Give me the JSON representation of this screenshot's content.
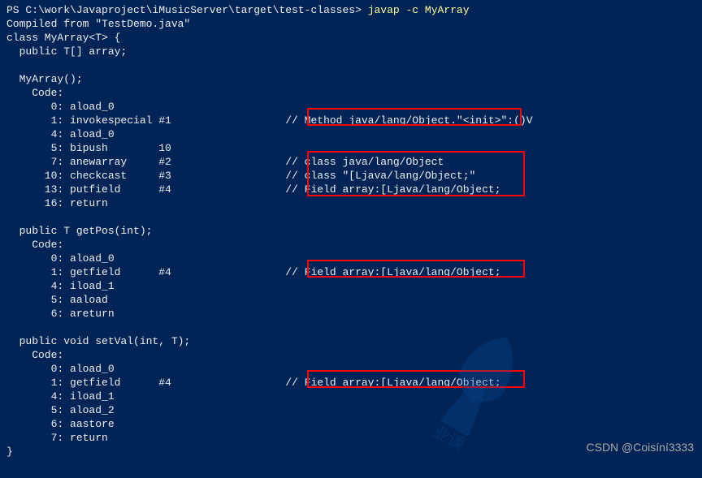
{
  "prompt_path": "PS C:\\work\\Javaproject\\iMusicServer\\target\\test-classes>",
  "command": "javap -c MyArray",
  "compiled_from": "Compiled from \"TestDemo.java\"",
  "class_decl": "class MyArray<T> {",
  "field_decl": "  public T[] array;",
  "constructor_sig": "  MyArray();",
  "code_label": "    Code:",
  "ctor_lines": [
    "       0: aload_0",
    "       1: invokespecial #1                  // Method java/lang/Object.\"<init>\":()V",
    "       4: aload_0",
    "       5: bipush        10",
    "       7: anewarray     #2                  // class java/lang/Object",
    "      10: checkcast     #3                  // class \"[Ljava/lang/Object;\"",
    "      13: putfield      #4                  // Field array:[Ljava/lang/Object;",
    "      16: return"
  ],
  "getpos_sig": "  public T getPos(int);",
  "getpos_lines": [
    "       0: aload_0",
    "       1: getfield      #4                  // Field array:[Ljava/lang/Object;",
    "       4: iload_1",
    "       5: aaload",
    "       6: areturn"
  ],
  "setval_sig": "  public void setVal(int, T);",
  "setval_lines": [
    "       0: aload_0",
    "       1: getfield      #4                  // Field array:[Ljava/lang/Object;",
    "       4: iload_1",
    "       5: aload_2",
    "       6: aastore",
    "       7: return"
  ],
  "close_brace": "}",
  "csdn_watermark": "CSDN @Coisíní3333"
}
